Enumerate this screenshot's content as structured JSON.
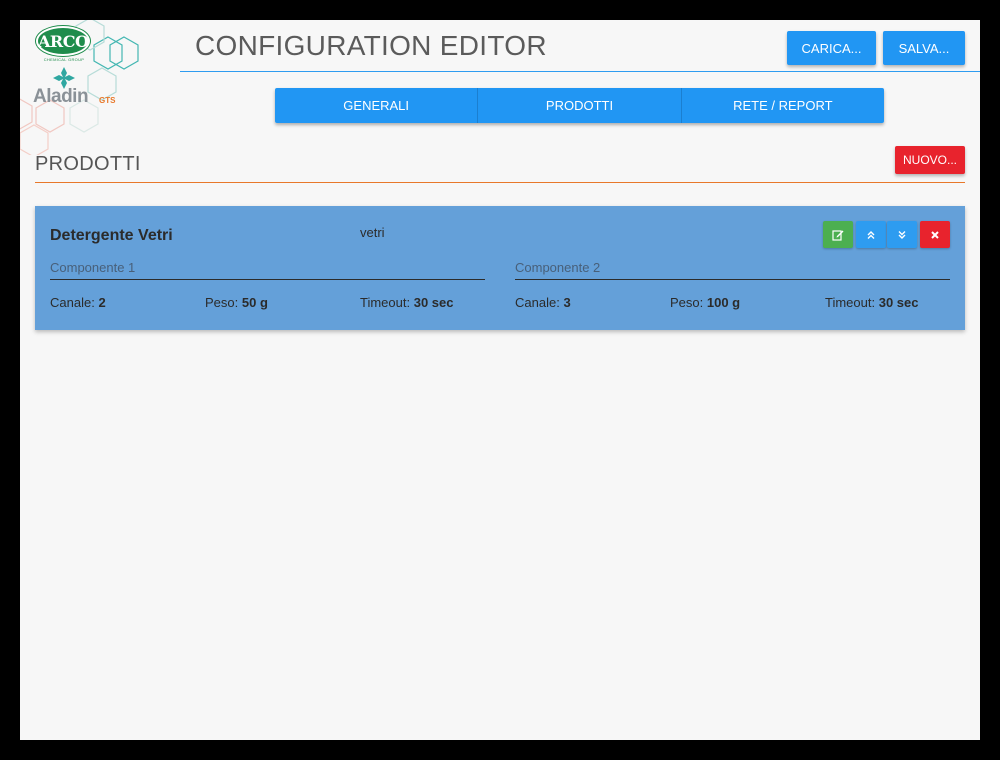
{
  "logo": {
    "company": "ARCO",
    "company_sub": "CHEMICAL GROUP",
    "product": "Aladin",
    "product_suffix": "GTS"
  },
  "header": {
    "title": "CONFIGURATION EDITOR",
    "load_label": "CARICA...",
    "save_label": "SALVA..."
  },
  "tabs": [
    {
      "label": "GENERALI"
    },
    {
      "label": "PRODOTTI"
    },
    {
      "label": "RETE / REPORT"
    }
  ],
  "section": {
    "title": "PRODOTTI",
    "new_label": "NUOVO..."
  },
  "products": [
    {
      "name": "Detergente Vetri",
      "code": "vetri",
      "components": [
        {
          "label": "Componente 1",
          "channel_label": "Canale:",
          "channel": "2",
          "weight_label": "Peso:",
          "weight": "50 g",
          "timeout_label": "Timeout:",
          "timeout": "30 sec"
        },
        {
          "label": "Componente 2",
          "channel_label": "Canale:",
          "channel": "3",
          "weight_label": "Peso:",
          "weight": "100 g",
          "timeout_label": "Timeout:",
          "timeout": "30 sec"
        }
      ]
    }
  ],
  "colors": {
    "primary": "#2196f3",
    "danger": "#e8232d",
    "success": "#4caf50",
    "card": "#64a0d9",
    "accent": "#e8782a"
  }
}
